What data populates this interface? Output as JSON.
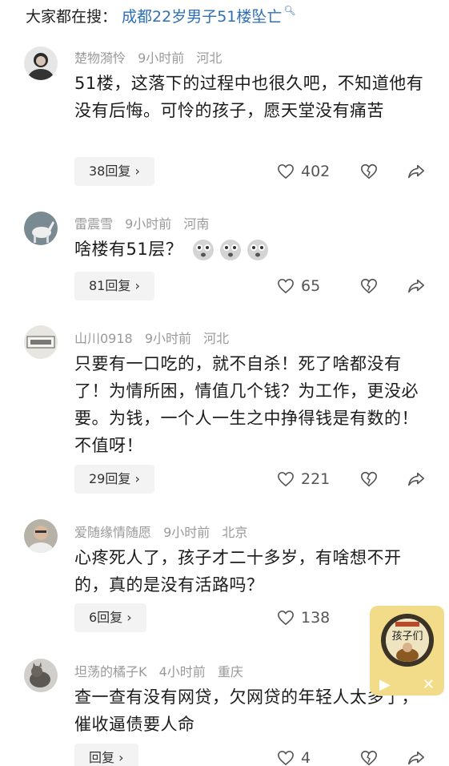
{
  "search_bar": {
    "prefix": "大家都在搜：",
    "query": "成都22岁男子51楼坠亡"
  },
  "comments": [
    {
      "username": "楚物漪怜",
      "time": "9小时前",
      "location": "河北",
      "text": "51楼，这落下的过程中也很久吧，不知道他有没有后悔。可怜的孩子，愿天堂没有痛苦",
      "reply_label": "38回复 ›",
      "likes": "402"
    },
    {
      "username": "雷震雪",
      "time": "9小时前",
      "location": "河南",
      "text": "啥楼有51层？",
      "reply_label": "81回复 ›",
      "likes": "65"
    },
    {
      "username": "山川0918",
      "time": "9小时前",
      "location": "河北",
      "text": "只要有一口吃的，就不自杀！死了啥都没有了！为情所困，情值几个钱？为工作，更没必要。为钱，一个人一生之中挣得钱是有数的！不值呀！",
      "reply_label": "29回复 ›",
      "likes": "221"
    },
    {
      "username": "爱随缘情随愿",
      "time": "9小时前",
      "location": "北京",
      "text": "心疼死人了，孩子才二十多岁，有啥想不开的，真的是没有活路吗？",
      "reply_label": "6回复 ›",
      "likes": "138"
    },
    {
      "username": "坦荡的橘子K",
      "time": "4小时前",
      "location": "重庆",
      "text": "查一查有没有网贷，欠网贷的年轻人太多了，催收逼债要人命",
      "reply_label": "回复 ›",
      "likes": "4"
    }
  ],
  "floating_player": {
    "title_text": "孩子们",
    "play_icon": "play-icon",
    "close_icon": "close-icon"
  },
  "colors": {
    "query_blue": "#2f6fb5",
    "meta_gray": "#9a9a9a",
    "reply_bg": "#f3f3f3",
    "player_bg": "#f2dc8a"
  }
}
